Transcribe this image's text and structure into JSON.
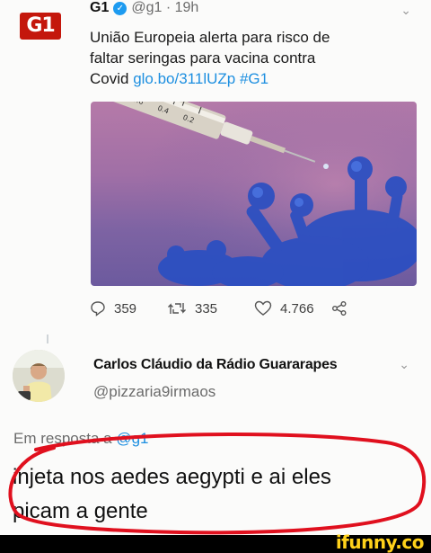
{
  "tweet": {
    "logo_text": "G1",
    "display_name": "G1",
    "handle_time": "@g1 · 19h",
    "text_lines": [
      "União Europeia alerta para risco de",
      "faltar seringas para vacina contra",
      "Covid "
    ],
    "link_text": "glo.bo/311lUZp",
    "hashtag": "#G1",
    "stats": {
      "replies": "359",
      "retweets": "335",
      "likes": "4.766"
    }
  },
  "reply": {
    "display_name": "Carlos Cláudio da Rádio Guararapes",
    "handle": "@pizzaria9irmaos",
    "in_reply_prefix": "Em resposta a ",
    "in_reply_handle": "@g1",
    "text_lines": [
      "injeta nos aedes aegypti e ai eles",
      "picam a gente"
    ]
  },
  "watermark": {
    "text": "ifunny.co"
  },
  "colors": {
    "accent_link": "#1d8fe0",
    "g1_red": "#c4170c",
    "highlight_circle": "#e0101e",
    "watermark": "#ffd11a"
  }
}
